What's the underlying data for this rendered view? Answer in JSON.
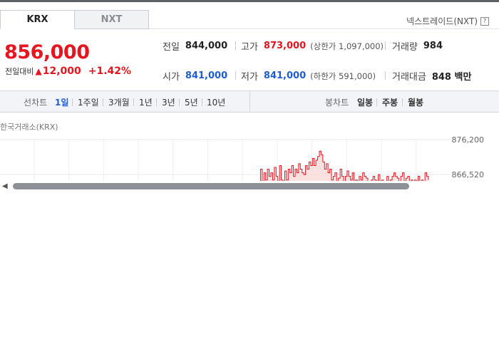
{
  "tabs": [
    {
      "label": "KRX",
      "active": true
    },
    {
      "label": "NXT",
      "active": false
    }
  ],
  "next_link": {
    "label": "넥스트레이드(NXT)",
    "icon": "help-icon"
  },
  "quote": {
    "price": "856,000",
    "change_label": "전일대비",
    "change_direction": "up",
    "change_value": "12,000",
    "change_pct": "+1.42%"
  },
  "stats": {
    "prev_close": {
      "label": "전일",
      "value": "844,000"
    },
    "high": {
      "label": "고가",
      "value": "873,000",
      "limit_label": "(상한가 1,097,000)"
    },
    "volume": {
      "label": "거래량",
      "value": "984"
    },
    "open": {
      "label": "시가",
      "value": "841,000"
    },
    "low": {
      "label": "저가",
      "value": "841,000",
      "limit_label": "(하한가 591,000)"
    },
    "amount": {
      "label": "거래대금",
      "value": "848 백만"
    }
  },
  "period_bar": {
    "line_chart_label": "선차트",
    "periods": [
      "1일",
      "1주일",
      "3개월",
      "1년",
      "3년",
      "5년",
      "10년"
    ],
    "selected_period": "1일",
    "candle_chart_label": "봉차트",
    "candle_periods": [
      "일봉",
      "주봉",
      "월봉"
    ]
  },
  "chart_caption": "한국거래소(KRX)",
  "colors": {
    "up": "#e8141e",
    "down": "#1e5bd6",
    "line": "#e8141e",
    "fill": "#fbdada"
  },
  "chart_data": {
    "type": "area",
    "title": "",
    "y_ticks": [
      "876,200",
      "866,520"
    ],
    "ylim": [
      856840,
      876200
    ],
    "x": [
      0,
      1,
      2,
      3,
      4,
      5,
      6,
      7,
      8,
      9,
      10,
      11,
      12,
      13,
      14,
      15,
      16,
      17,
      18,
      19,
      20,
      21,
      22,
      23,
      24,
      25,
      26,
      27,
      28,
      29,
      30,
      31,
      32,
      33,
      34,
      35,
      36,
      37,
      38,
      39,
      40,
      41,
      42,
      43,
      44,
      45,
      46,
      47,
      48,
      49,
      50,
      51,
      52,
      53,
      54,
      55,
      56,
      57,
      58,
      59,
      60,
      61,
      62,
      63,
      64,
      65,
      66,
      67,
      68,
      69,
      70,
      71,
      72,
      73,
      74,
      75,
      76,
      77,
      78,
      79,
      80,
      81,
      82,
      83,
      84,
      85,
      86,
      87,
      88,
      89,
      90,
      91,
      92,
      93,
      94,
      95,
      96,
      97,
      98
    ],
    "values": [
      862000,
      868000,
      864000,
      867000,
      865000,
      868000,
      866000,
      867000,
      865000,
      868500,
      866000,
      863000,
      869000,
      865000,
      864000,
      867500,
      865000,
      868000,
      867000,
      869000,
      866000,
      868000,
      867000,
      869500,
      868000,
      867000,
      866500,
      869000,
      868000,
      870000,
      869000,
      871000,
      869000,
      870500,
      871500,
      873000,
      872000,
      870000,
      868000,
      869500,
      867000,
      868000,
      865000,
      866000,
      867000,
      864000,
      865500,
      868000,
      866000,
      864000,
      866000,
      867500,
      866000,
      865000,
      867000,
      864000,
      865000,
      864000,
      866000,
      865000,
      867000,
      866000,
      865500,
      864000,
      862000,
      865000,
      866000,
      865000,
      864500,
      866500,
      864000,
      865000,
      863000,
      862000,
      866000,
      864000,
      865000,
      866000,
      867000,
      866000,
      865500,
      864000,
      866000,
      867000,
      864000,
      865500,
      866000,
      863500,
      865000,
      864000,
      865000,
      864500,
      866000,
      864000,
      865000,
      864000,
      867000,
      866000,
      865000
    ]
  }
}
